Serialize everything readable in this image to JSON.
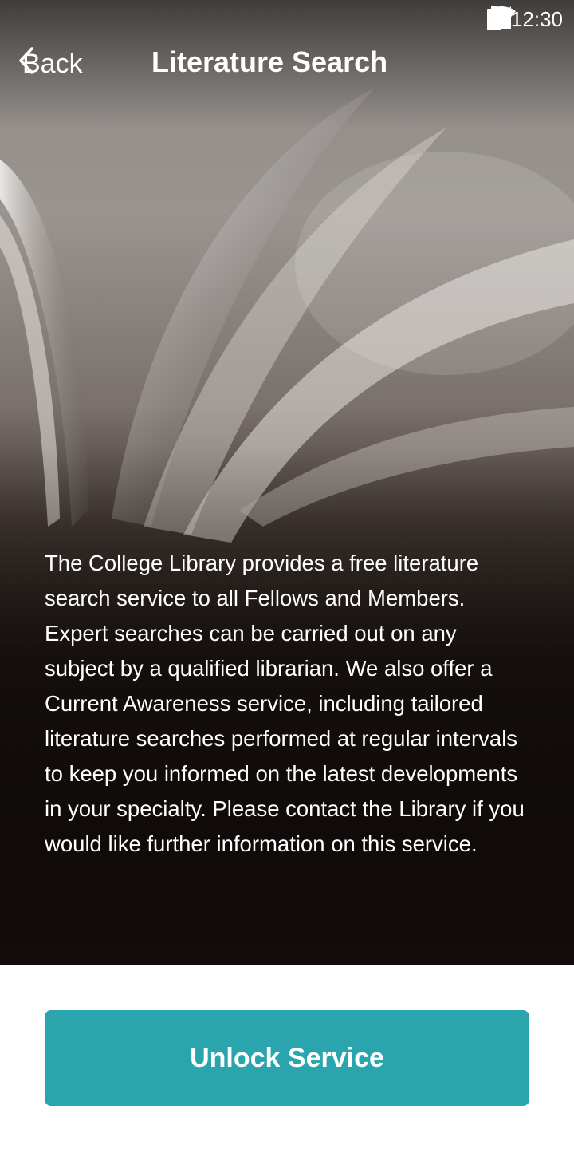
{
  "status_bar": {
    "time": "12:30",
    "icons": [
      "wifi-icon",
      "cellular-signal-icon",
      "battery-icon"
    ]
  },
  "header": {
    "back_label": "Back",
    "title": "Literature Search"
  },
  "content": {
    "description": "The College Library provides a free literature search service to all Fellows and Members. Expert searches can be carried out on any subject by a qualified librarian. We also offer a Current Awareness service, including tailored literature searches performed at regular intervals to keep you informed on the latest developments in your specialty. Please contact the Library if you would like further information on this service."
  },
  "actions": {
    "unlock_label": "Unlock Service"
  },
  "colors": {
    "accent": "#2aa4ad",
    "text_on_dark": "#ffffff"
  }
}
